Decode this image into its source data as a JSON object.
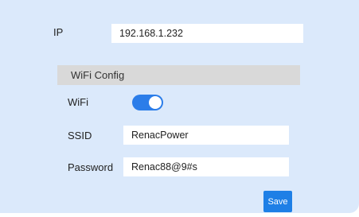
{
  "network": {
    "ip_label": "IP",
    "ip_value": "192.168.1.232"
  },
  "wifi_config": {
    "section_title": "WiFi Config",
    "wifi_label": "WiFi",
    "wifi_enabled": true,
    "ssid_label": "SSID",
    "ssid_value": "RenacPower",
    "password_label": "Password",
    "password_value": "Renac88@9#s"
  },
  "actions": {
    "save_label": "Save"
  },
  "colors": {
    "panel_bg": "#dbe9fb",
    "accent": "#1e7fe6",
    "section_header_bg": "#d9d9d9"
  }
}
